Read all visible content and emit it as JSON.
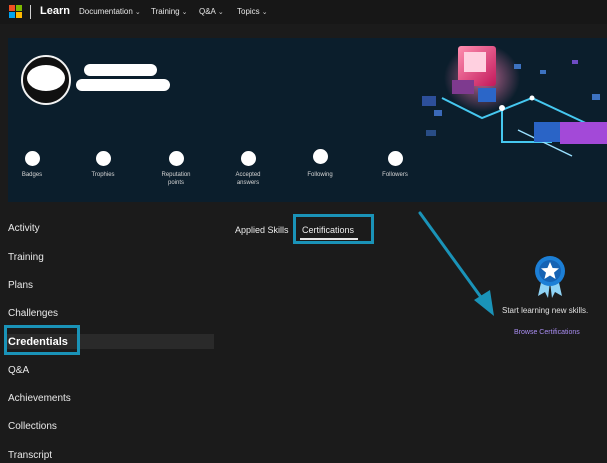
{
  "topnav": {
    "brand": "Learn",
    "items": [
      {
        "label": "Documentation"
      },
      {
        "label": "Training"
      },
      {
        "label": "Q&A"
      },
      {
        "label": "Topics"
      }
    ],
    "chevron": "⌄"
  },
  "profile": {
    "stats": [
      {
        "label": "Badges"
      },
      {
        "label": "Trophies"
      },
      {
        "label": "Reputation points"
      },
      {
        "label": "Accepted answers"
      },
      {
        "label": "Following"
      },
      {
        "label": "Followers"
      }
    ]
  },
  "sidebar": {
    "items": [
      {
        "label": "Activity"
      },
      {
        "label": "Training"
      },
      {
        "label": "Plans"
      },
      {
        "label": "Challenges"
      },
      {
        "label": "Credentials",
        "active": true
      },
      {
        "label": "Q&A"
      },
      {
        "label": "Achievements"
      },
      {
        "label": "Collections"
      },
      {
        "label": "Transcript"
      }
    ]
  },
  "tabs": [
    {
      "label": "Applied Skills"
    },
    {
      "label": "Certifications",
      "active": true
    }
  ],
  "empty_state": {
    "message": "Start learning new skills.",
    "link": "Browse Certifications"
  },
  "colors": {
    "highlight": "#1a93b8",
    "link": "#a98df2",
    "badge": "#1c7fd6"
  }
}
